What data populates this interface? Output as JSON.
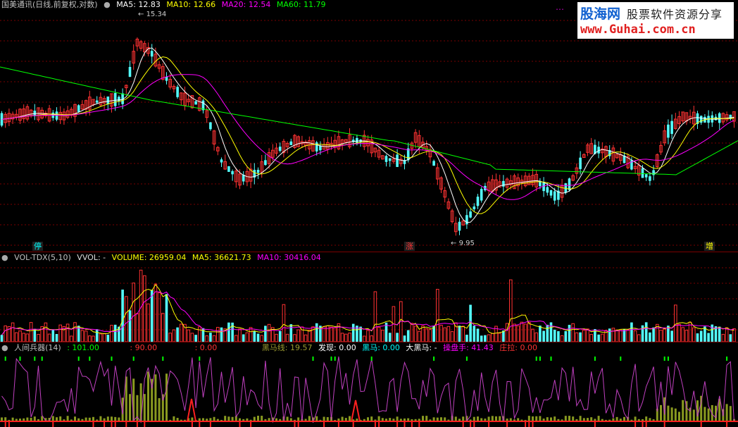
{
  "price_panel": {
    "title": "国美通讯(日线,前复权,对数)",
    "ma": [
      {
        "label": "MA5: 12.83",
        "color": "#ffffff"
      },
      {
        "label": "MA10: 12.66",
        "color": "#ffff00"
      },
      {
        "label": "MA20: 12.54",
        "color": "#ff00ff"
      },
      {
        "label": "MA60: 11.79",
        "color": "#00ff00"
      }
    ],
    "high_label": "15.34",
    "low_label": "9.95",
    "badges": [
      "停",
      "涨",
      "增"
    ],
    "dots": "⋯"
  },
  "volume_panel": {
    "title": "VOL-TDX(5,10)",
    "vvol": "VVOL: -",
    "volume": "VOLUME: 26959.04",
    "ma5": "MA5: 36621.73",
    "ma10": "MA10: 30416.04"
  },
  "indicator_panel": {
    "title": "人间兵器(14)",
    "v1": ": 101.00",
    "v2": ": 90.00",
    "v3": ": 0.00",
    "hm_line": "黑马线: 19.57",
    "discover": "发现: 0.00",
    "dark_horse": "黑马: 0.00",
    "big_dark_horse": "大黑马: -",
    "operator": "操盘手: 41.43",
    "pull": "庄拉: 0.00"
  },
  "logo": {
    "name": "股海网",
    "slogan": "股票软件资源分享",
    "url": "www.Guhai.com.cn"
  },
  "colors": {
    "up": "#ff3232",
    "down": "#54ffff",
    "ma5": "#ffffff",
    "ma10": "#ffff00",
    "ma20": "#ff00ff",
    "ma60": "#00ff00",
    "grid": "#7a0000"
  }
}
